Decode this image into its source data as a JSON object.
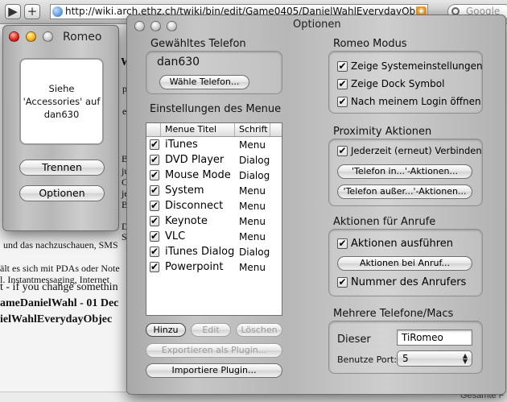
{
  "browser": {
    "back_label": "▶",
    "add_label": "+",
    "url": "http://wiki.arch.ethz.ch/twiki/bin/edit/Game0405/DanielWahlEverydayObj",
    "search_placeholder": "Google",
    "background_lines": [
      "W",
      "p",
      "e",
      "B",
      "ju",
      "C",
      "je",
      "B",
      "D",
      "Sc",
      "und das nachzuschauen, SMS",
      "ält es sich mit PDAs oder Note",
      "l. Instantmessaging, Internet",
      "t - if you change somethin",
      "ameDanielWahl - 01 Dec",
      "ielWahlEverydayObjec",
      "Gesamte F"
    ]
  },
  "romeo_window": {
    "title": "Romeo",
    "status_line1": "Siehe",
    "status_line2": "'Accessories' auf",
    "status_line3": "dan630",
    "disconnect_label": "Trennen",
    "options_label": "Optionen"
  },
  "options_window": {
    "title": "Optionen",
    "phone_group_title": "Gewähltes Telefon",
    "phone_name": "dan630",
    "choose_phone_label": "Wähle Telefon...",
    "menu_settings_title": "Einstellungen des Menue",
    "menu_columns": {
      "title": "Menue Titel",
      "font": "Schrift"
    },
    "menu_items": [
      {
        "checked": "✔",
        "title": "iTunes",
        "font": "Menu"
      },
      {
        "checked": "✔",
        "title": "DVD Player",
        "font": "Dialog"
      },
      {
        "checked": "✔",
        "title": "Mouse Mode",
        "font": "Dialog"
      },
      {
        "checked": "✔",
        "title": "System",
        "font": "Menu"
      },
      {
        "checked": "✔",
        "title": "Disconnect",
        "font": "Menu"
      },
      {
        "checked": "✔",
        "title": "Keynote",
        "font": "Menu"
      },
      {
        "checked": "✔",
        "title": "VLC",
        "font": "Menu"
      },
      {
        "checked": "✔",
        "title": "iTunes Dialog",
        "font": "Dialog"
      },
      {
        "checked": "✔",
        "title": "Powerpoint",
        "font": "Menu"
      }
    ],
    "add_label": "Hinzu",
    "edit_label": "Edit",
    "delete_label": "Löschen",
    "export_plugin_label": "Exportieren als Plugin...",
    "import_plugin_label": "Importiere Plugin...",
    "romeo_mode_title": "Romeo Modus",
    "romeo_mode_options": [
      {
        "checked": "✔",
        "label": "Zeige Systemeinstellungen"
      },
      {
        "checked": "✔",
        "label": "Zeige Dock Symbol"
      },
      {
        "checked": "✔",
        "label": "Nach meinem Login öffnen"
      }
    ],
    "proximity_title": "Proximity Aktionen",
    "proximity_option": {
      "checked": "✔",
      "label": "Jederzeit (erneut) Verbinden"
    },
    "phone_in_label": "'Telefon in...'-Aktionen...",
    "phone_out_label": "'Telefon außer...'-Aktionen...",
    "call_actions_title": "Aktionen für Anrufe",
    "call_actions_option": {
      "checked": "✔",
      "label": "Aktionen ausführen"
    },
    "call_actions_button_label": "Aktionen bei Anruf...",
    "caller_number_option": {
      "checked": "✔",
      "label": "Nummer des Anrufers"
    },
    "multi_phones_title": "Mehrere Telefone/Macs",
    "this_label": "Dieser",
    "this_value": "TiRomeo",
    "port_label": "Benutze Port:",
    "port_value": "5",
    "port_arrows": "▲▼"
  }
}
